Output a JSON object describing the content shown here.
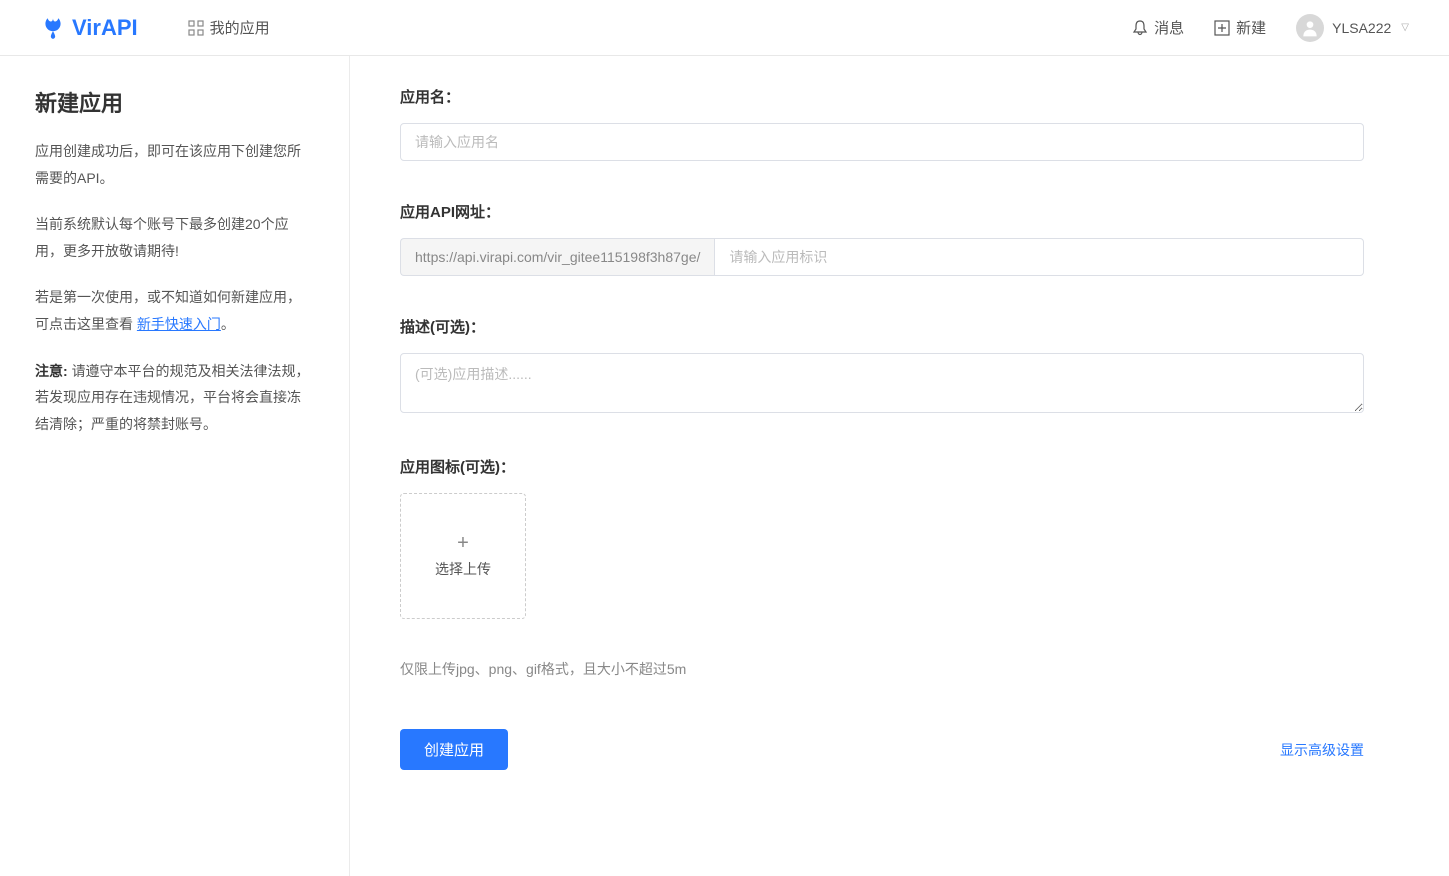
{
  "header": {
    "logo_text": "VirAPI",
    "nav_my_apps": "我的应用",
    "messages": "消息",
    "new": "新建",
    "username": "YLSA222"
  },
  "sidebar": {
    "title": "新建应用",
    "p1": "应用创建成功后，即可在该应用下创建您所需要的API。",
    "p2": "当前系统默认每个账号下最多创建20个应用，更多开放敬请期待!",
    "p3_prefix": "若是第一次使用，或不知道如何新建应用，可点击这里查看 ",
    "p3_link": "新手快速入门",
    "p3_suffix": "。",
    "p4_strong": "注意: ",
    "p4_text": "请遵守本平台的规范及相关法律法规，若发现应用存在违规情况，平台将会直接冻结清除；严重的将禁封账号。"
  },
  "form": {
    "app_name_label": "应用名：",
    "app_name_placeholder": "请输入应用名",
    "api_url_label": "应用API网址：",
    "api_url_prefix": "https://api.virapi.com/vir_gitee115198f3h87ge/",
    "api_url_placeholder": "请输入应用标识",
    "desc_label": "描述(可选)：",
    "desc_placeholder": "(可选)应用描述......",
    "icon_label": "应用图标(可选)：",
    "upload_text": "选择上传",
    "upload_hint": "仅限上传jpg、png、gif格式，且大小不超过5m",
    "submit_label": "创建应用",
    "advanced_link": "显示高级设置"
  }
}
